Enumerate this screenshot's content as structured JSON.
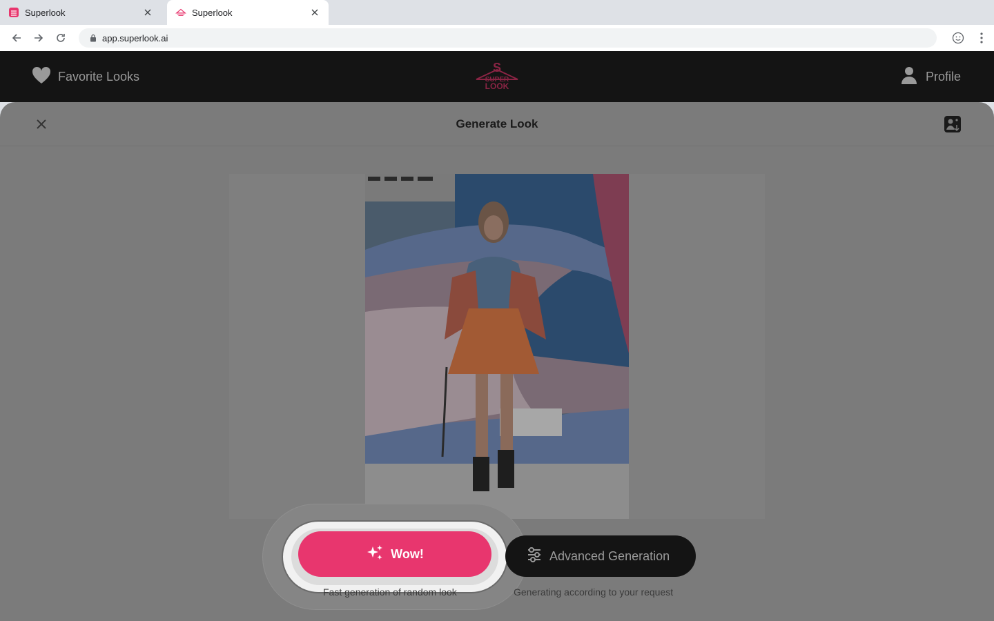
{
  "browser": {
    "tabs": [
      {
        "title": "Superlook"
      },
      {
        "title": "Superlook"
      }
    ],
    "url": "app.superlook.ai"
  },
  "header": {
    "favorites_label": "Favorite Looks",
    "logo_text": [
      "SUPER",
      "LOOK"
    ],
    "profile_label": "Profile"
  },
  "modal": {
    "title": "Generate Look",
    "wow_label": "Wow!",
    "wow_caption": "Fast generation of random look",
    "advanced_label": "Advanced Generation",
    "advanced_caption": "Generating according to your request"
  },
  "colors": {
    "accent": "#e8366e",
    "header_bg": "#141414"
  }
}
